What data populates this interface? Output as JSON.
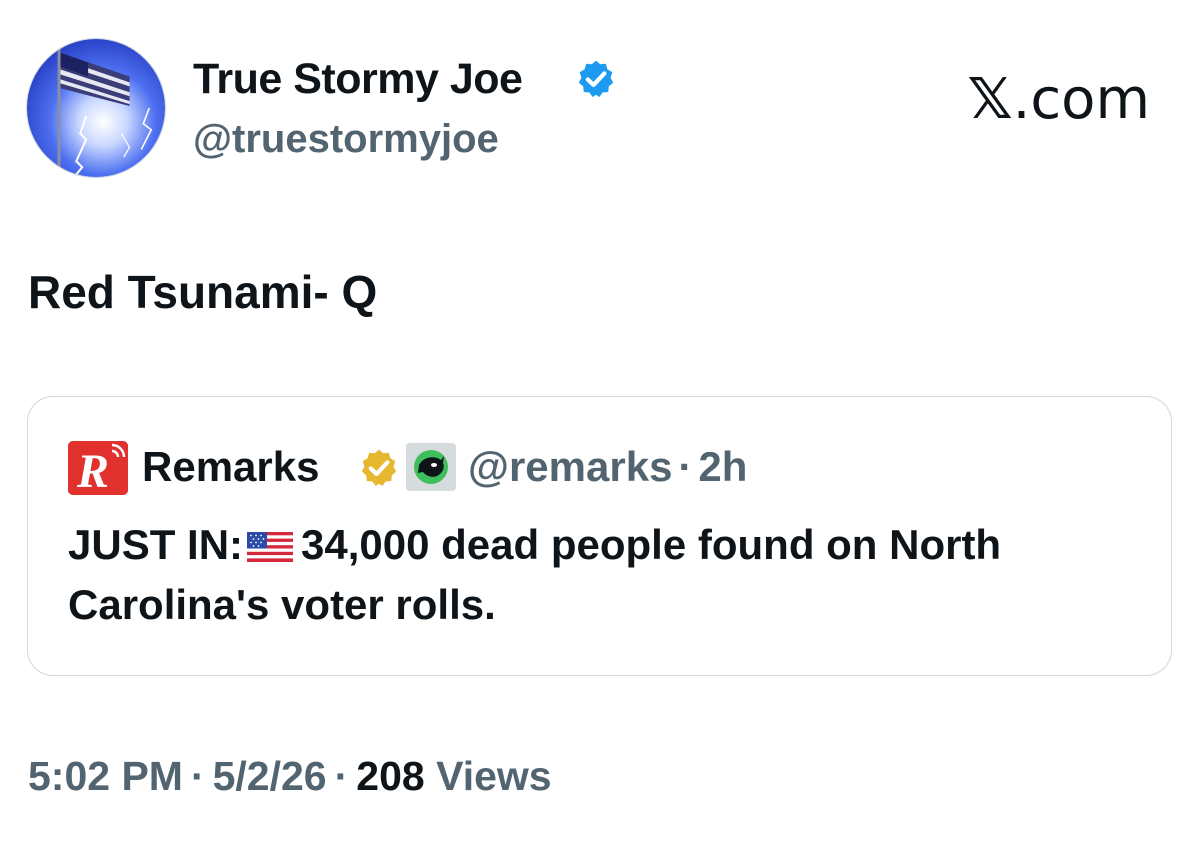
{
  "author": {
    "display_name": "True Stormy Joe",
    "handle": "@truestormyjoe",
    "avatar": "flag-and-lightning-avatar",
    "verified_badge": "blue-check-icon"
  },
  "site_logo": {
    "mark": "𝕏",
    "suffix": ".com"
  },
  "tweet": {
    "text": "Red Tsunami- Q"
  },
  "quote": {
    "logo": "remarks-r-logo",
    "name": "Remarks",
    "gold_badge": "gold-check-icon",
    "affiliate_badge": "orca-affiliate-icon",
    "handle": "@remarks",
    "separator": "·",
    "age": "2h",
    "body_prefix": "JUST IN:",
    "flag": "us-flag-emoji",
    "body_suffix": "34,000 dead people found on North Carolina's voter rolls."
  },
  "footer": {
    "time": "5:02 PM",
    "date": "5/2/26",
    "views_count": "208",
    "views_label": "Views",
    "separator": "·"
  },
  "colors": {
    "text_primary": "#0f1419",
    "text_secondary": "#536471",
    "border": "#cfd9de",
    "verified_blue": "#1d9bf0",
    "verified_gold": "#e8b730",
    "remarks_red": "#e0312f"
  }
}
